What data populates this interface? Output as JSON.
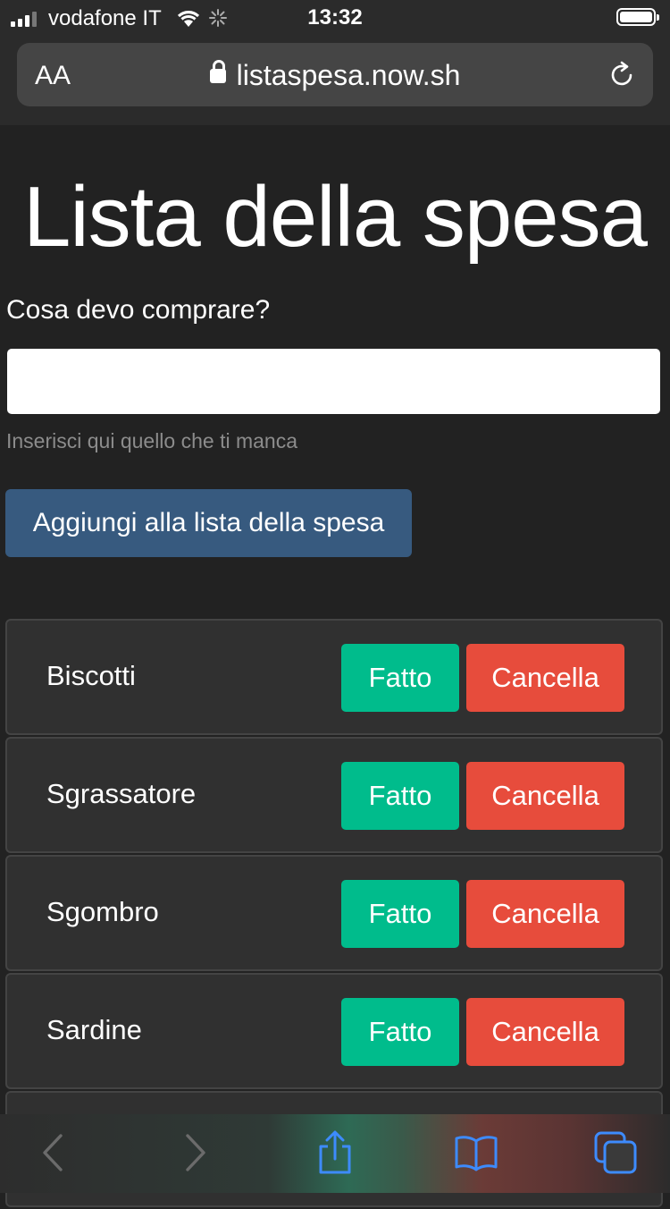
{
  "status": {
    "carrier": "vodafone IT",
    "time": "13:32"
  },
  "browser": {
    "text_size": "AA",
    "url": "listaspesa.now.sh"
  },
  "page": {
    "title": "Lista della spesa",
    "question": "Cosa devo comprare?",
    "input_value": "",
    "help": "Inserisci qui quello che ti manca",
    "add_button": "Aggiungi alla lista della spesa"
  },
  "items": [
    {
      "name": "Biscotti",
      "done_label": "Fatto",
      "delete_label": "Cancella"
    },
    {
      "name": "Sgrassatore",
      "done_label": "Fatto",
      "delete_label": "Cancella"
    },
    {
      "name": "Sgombro",
      "done_label": "Fatto",
      "delete_label": "Cancella"
    },
    {
      "name": "Sardine",
      "done_label": "Fatto",
      "delete_label": "Cancella"
    }
  ],
  "colors": {
    "done": "#00bc8c",
    "delete": "#e74c3c",
    "primary": "#375a7f",
    "background": "#222222"
  },
  "icons": [
    "signal-icon",
    "wifi-icon",
    "loading-spinner-icon",
    "battery-icon",
    "lock-icon",
    "reload-icon",
    "back-icon",
    "forward-icon",
    "share-icon",
    "bookmarks-icon",
    "tabs-icon"
  ]
}
